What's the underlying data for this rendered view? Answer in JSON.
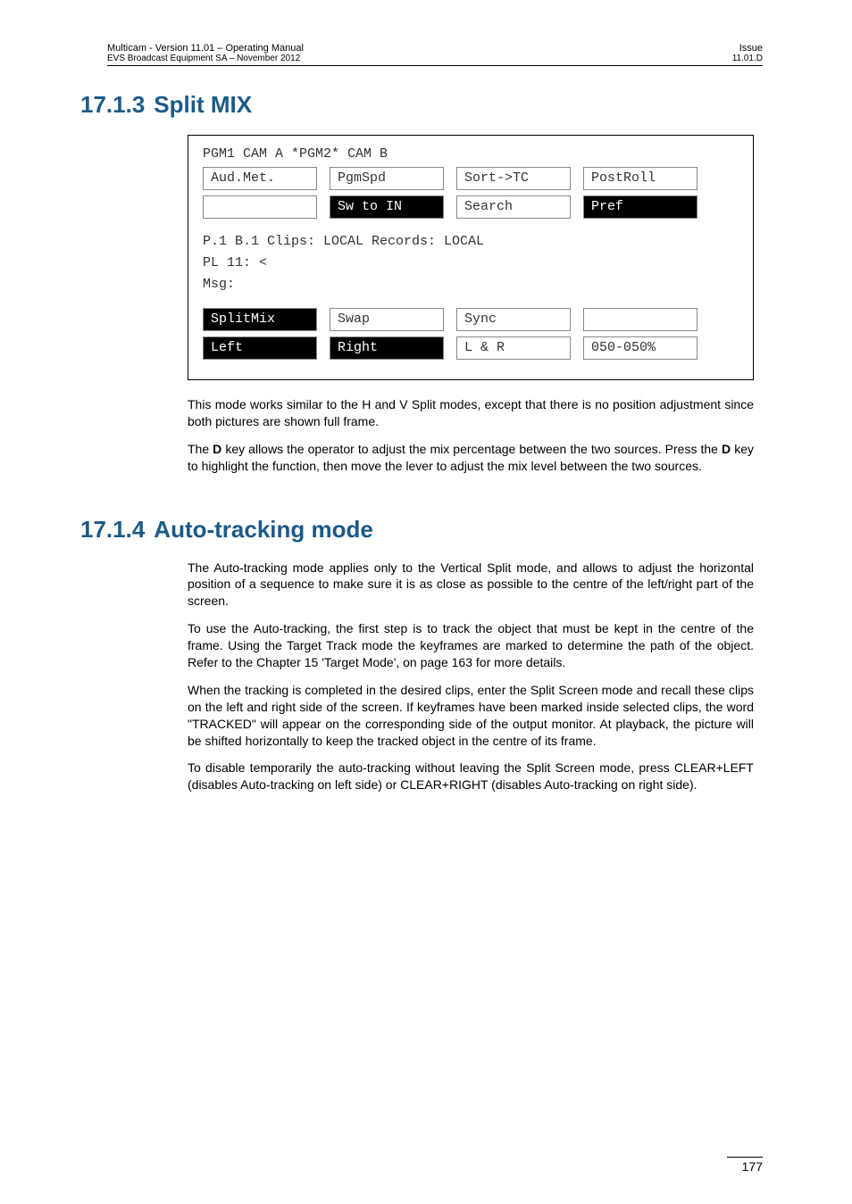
{
  "header": {
    "left_line1": "Multicam - Version 11.01 – Operating Manual",
    "left_line2": "EVS Broadcast Equipment SA – November 2012",
    "right_line1": "Issue",
    "right_line2": "11.01.D"
  },
  "section1": {
    "number": "17.1.3",
    "title": "Split MIX"
  },
  "ui": {
    "statusline": "PGM1 CAM A          *PGM2* CAM B",
    "row1": {
      "c1": "Aud.Met.",
      "c2": "PgmSpd",
      "c3": "Sort->TC",
      "c4": "PostRoll"
    },
    "row2": {
      "c1": "",
      "c2": "Sw to IN",
      "c3": "Search",
      "c4": "Pref"
    },
    "mid_line1": "P.1   B.1  Clips: LOCAL Records: LOCAL",
    "mid_line2": "PL 11: <",
    "mid_line3": "Msg:",
    "row3": {
      "c1": "SplitMix",
      "c2": "Swap",
      "c3": "Sync",
      "c4": ""
    },
    "row4": {
      "c1": "Left",
      "c2": "Right",
      "c3": "L & R",
      "c4": "050-050%"
    }
  },
  "para1": "This mode works similar to the H and V Split modes, except that there is no position adjustment since both pictures are shown full frame.",
  "para2_pre": "The ",
  "para2_b1": "D",
  "para2_mid": " key allows the operator to adjust the mix percentage between the two sources. Press the ",
  "para2_b2": "D",
  "para2_post": " key to highlight the function, then move the lever to adjust the mix level between the two sources.",
  "section2": {
    "number": "17.1.4",
    "title": "Auto-tracking mode"
  },
  "s2_para1": "The Auto-tracking mode applies only to the Vertical Split mode, and allows to adjust the horizontal position of a sequence to make sure it is as close as possible to the centre of the left/right part of the screen.",
  "s2_para2": "To use the Auto-tracking, the first step is to track the object that must be kept in the centre of the frame. Using the Target Track mode the keyframes are marked to determine the path of the object. Refer to the Chapter 15 'Target Mode', on page 163 for more details.",
  "s2_para3": "When the tracking is completed in the desired clips, enter the Split Screen mode and recall these clips on the left and right side of the screen. If keyframes have been marked inside selected clips, the word \"TRACKED\" will appear on the corresponding side of the output monitor. At playback, the picture will be shifted horizontally to keep the tracked object in the centre of its frame.",
  "s2_para4": "To disable temporarily the auto-tracking without leaving the Split Screen mode, press CLEAR+LEFT (disables Auto-tracking on left side) or CLEAR+RIGHT (disables Auto-tracking on right side).",
  "page_number": "177"
}
